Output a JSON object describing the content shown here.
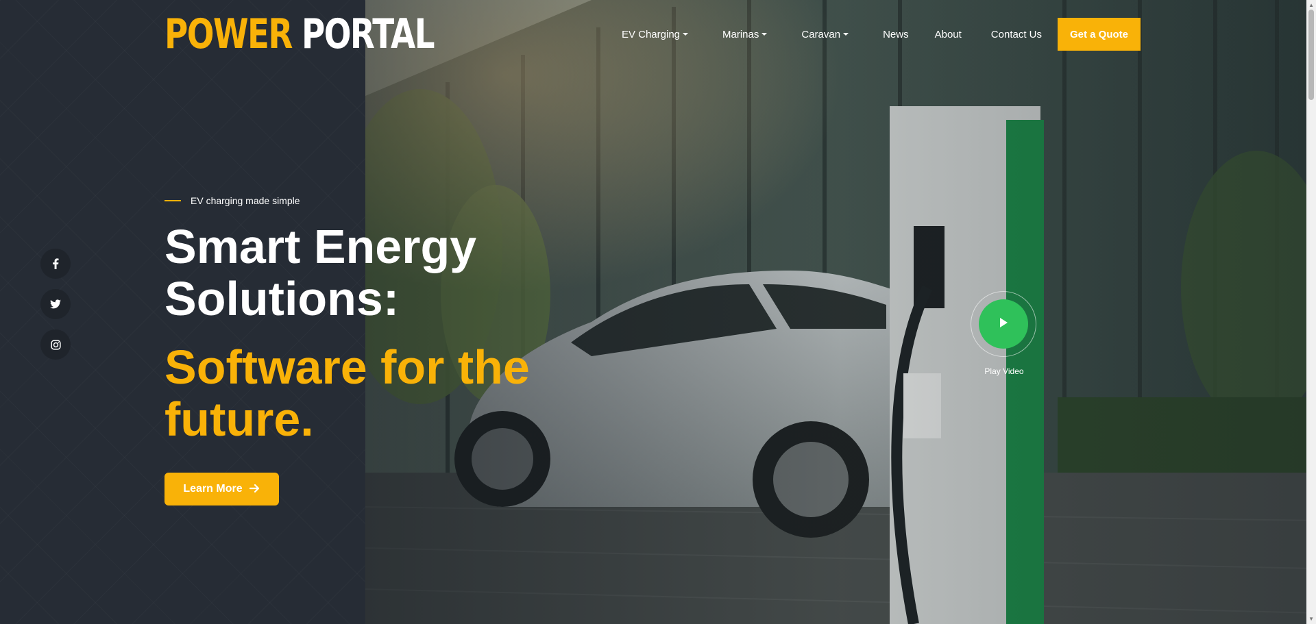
{
  "brand": {
    "logo_part1": "POWER",
    "logo_part2": "PORTAL"
  },
  "nav": {
    "items": [
      {
        "label": "EV Charging",
        "has_dropdown": true
      },
      {
        "label": "Marinas",
        "has_dropdown": true
      },
      {
        "label": "Caravan",
        "has_dropdown": true
      },
      {
        "label": "News",
        "has_dropdown": false
      },
      {
        "label": "About",
        "has_dropdown": false
      },
      {
        "label": "Contact Us",
        "has_dropdown": false
      }
    ],
    "cta_label": "Get a Quote"
  },
  "hero": {
    "eyebrow": "EV charging made simple",
    "title_line1": "Smart Energy",
    "title_line2": "Solutions:",
    "subtitle_line1": "Software for the",
    "subtitle_line2": "future.",
    "button_label": "Learn More",
    "play_label": "Play Video"
  },
  "social": [
    {
      "icon": "facebook-icon"
    },
    {
      "icon": "twitter-icon"
    },
    {
      "icon": "instagram-icon"
    }
  ],
  "colors": {
    "accent": "#f9b208",
    "panel": "#262c35",
    "play_button": "#2fc15a",
    "text": "#ffffff"
  }
}
